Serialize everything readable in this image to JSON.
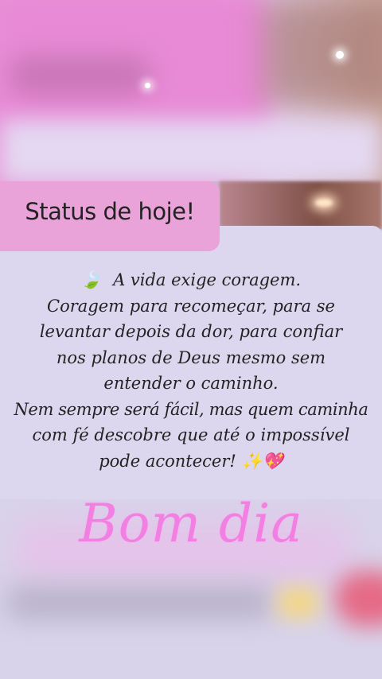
{
  "status_tag": "Status de hoje!",
  "quote": {
    "leaf_icon": "🍃",
    "lines": [
      "A vida exige coragem.",
      "Coragem para recomeçar, para se",
      "levantar depois da dor, para confiar",
      "nos planos de Deus mesmo sem",
      "entender o caminho.",
      "Nem sempre será fácil,  mas quem caminha",
      "com fé descobre que até o impossível",
      "pode acontecer!"
    ],
    "end_emojis": "✨💖"
  },
  "greeting": "Bom dia",
  "colors": {
    "tag_pink": "#e9a3d9",
    "card_lavender": "#dcd7ef",
    "greeting_pink": "#f27fe2"
  }
}
